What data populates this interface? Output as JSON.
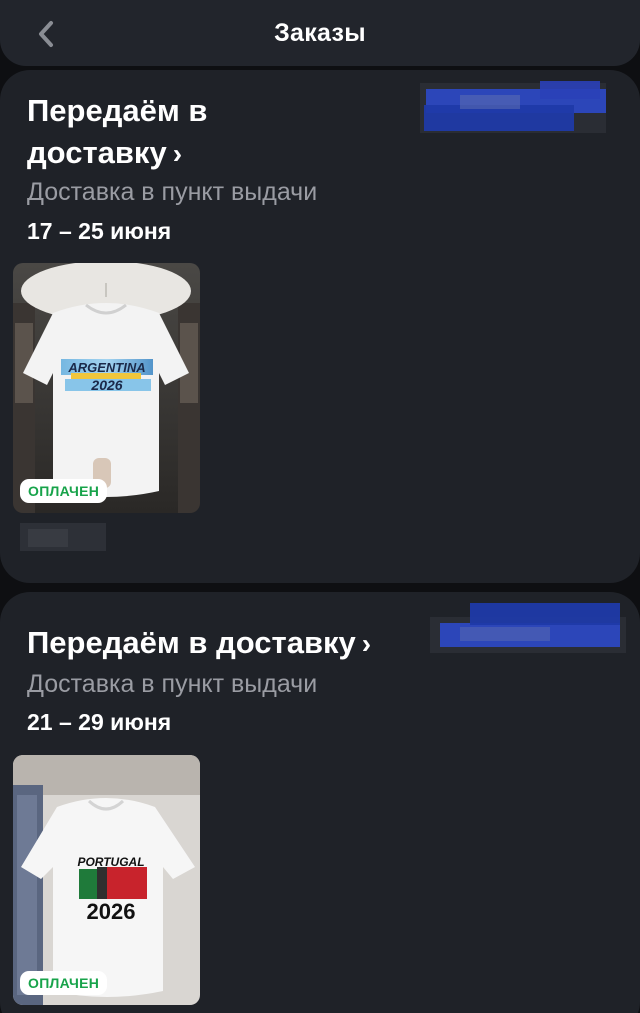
{
  "header": {
    "title": "Заказы",
    "back_icon": "chevron-left-icon"
  },
  "orders": [
    {
      "status": "Передаём в доставку",
      "chevron": "›",
      "delivery_type": "Доставка в пункт выдачи",
      "dates": "17 – 25 июня",
      "product": {
        "print_text": "ARGENTINA",
        "print_year": "2026",
        "badge": "ОПЛАЧЕН"
      }
    },
    {
      "status": "Передаём в доставку",
      "chevron": "›",
      "delivery_type": "Доставка в пункт выдачи",
      "dates": "21 – 29 июня",
      "product": {
        "print_text": "PORTUGAL",
        "print_year": "2026",
        "badge": "ОПЛАЧЕН"
      }
    }
  ],
  "colors": {
    "background": "#0e0f12",
    "card": "#1f2228",
    "header": "#22252c",
    "secondary_text": "#9a9ca3",
    "paid_green": "#17a34a",
    "redaction_blue": "#2c49c8"
  }
}
